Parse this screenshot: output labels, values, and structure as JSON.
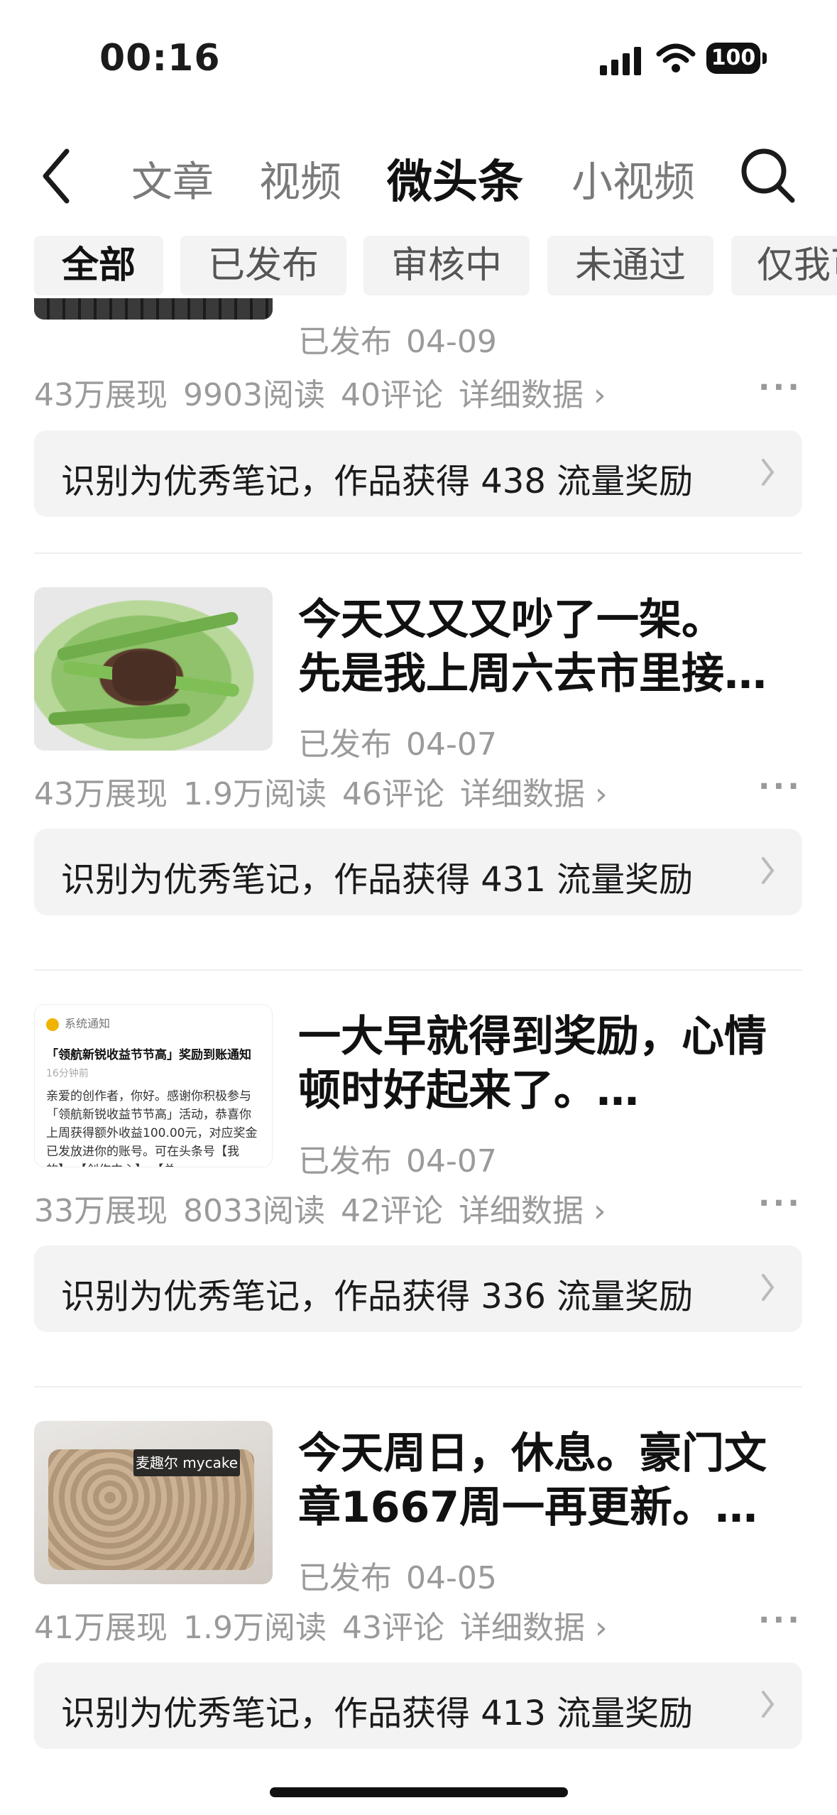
{
  "status_bar": {
    "time": "00:16",
    "battery": "100"
  },
  "nav": {
    "tabs": [
      {
        "label": "文章"
      },
      {
        "label": "视频"
      },
      {
        "label": "微头条",
        "active": true
      },
      {
        "label": "小视频"
      }
    ]
  },
  "filters": [
    {
      "label": "全部",
      "active": true
    },
    {
      "label": "已发布"
    },
    {
      "label": "审核中"
    },
    {
      "label": "未通过"
    },
    {
      "label": "仅我可见"
    }
  ],
  "items": [
    {
      "title_line1": "",
      "title_line2": "",
      "status": "已发布",
      "date": "04-09",
      "impressions": "43万展现",
      "reads": "9903阅读",
      "comments": "40评论",
      "detail": "详细数据",
      "reward": "识别为优秀笔记，作品获得 438 流量奖励"
    },
    {
      "title_line1": "今天又又又吵了一架。",
      "title_line2": "先是我上周六去市里接…",
      "status": "已发布",
      "date": "04-07",
      "impressions": "43万展现",
      "reads": "1.9万阅读",
      "comments": "46评论",
      "detail": "详细数据",
      "reward": "识别为优秀笔记，作品获得 431 流量奖励"
    },
    {
      "title_line1": "一大早就得到奖励，心情",
      "title_line2": "顿时好起来了。…",
      "status": "已发布",
      "date": "04-07",
      "impressions": "33万展现",
      "reads": "8033阅读",
      "comments": "42评论",
      "detail": "详细数据",
      "reward": "识别为优秀笔记，作品获得 336 流量奖励",
      "thumb_notice": {
        "header": "系统通知",
        "title": "「领航新锐收益节节高」奖励到账通知",
        "ago": "16分钟前",
        "body": "亲爱的创作者，你好。感谢你积极参与「领航新锐收益节节高」活动，恭喜你上周获得额外收益100.00元，对应奖金已发放进你的账号。可在头条号【我的】-【创作中心】-【总"
      }
    },
    {
      "title_line1": "今天周日，休息。豪门文",
      "title_line2": "章1667周一再更新。…",
      "status": "已发布",
      "date": "04-05",
      "impressions": "41万展现",
      "reads": "1.9万阅读",
      "comments": "43评论",
      "detail": "详细数据",
      "reward": "识别为优秀笔记，作品获得 413 流量奖励",
      "thumb_label": "麦趣尔 mycake"
    }
  ],
  "colors": {
    "chip_bg": "#f3f3f3",
    "reward_bg": "#f3f3f3",
    "muted": "#9a9a9a"
  }
}
